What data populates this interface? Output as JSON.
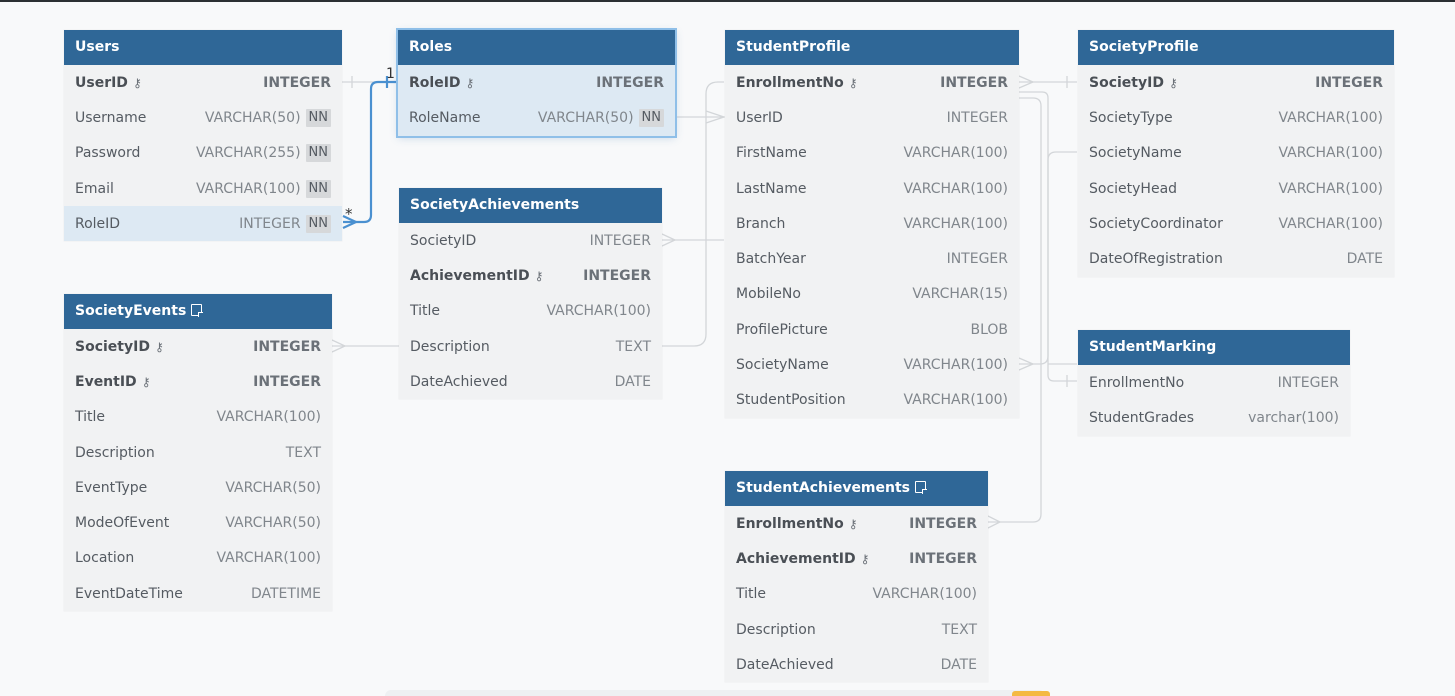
{
  "tables": {
    "users": {
      "name": "Users",
      "fields": [
        {
          "name": "UserID",
          "type": "INTEGER",
          "pk": true
        },
        {
          "name": "Username",
          "type": "VARCHAR(50)",
          "nn": "NN"
        },
        {
          "name": "Password",
          "type": "VARCHAR(255)",
          "nn": "NN"
        },
        {
          "name": "Email",
          "type": "VARCHAR(100)",
          "nn": "NN"
        },
        {
          "name": "RoleID",
          "type": "INTEGER",
          "nn": "NN"
        }
      ]
    },
    "roles": {
      "name": "Roles",
      "fields": [
        {
          "name": "RoleID",
          "type": "INTEGER",
          "pk": true
        },
        {
          "name": "RoleName",
          "type": "VARCHAR(50)",
          "nn": "NN"
        }
      ]
    },
    "society_achievements": {
      "name": "SocietyAchievements",
      "fields": [
        {
          "name": "SocietyID",
          "type": "INTEGER"
        },
        {
          "name": "AchievementID",
          "type": "INTEGER",
          "pk": true
        },
        {
          "name": "Title",
          "type": "VARCHAR(100)"
        },
        {
          "name": "Description",
          "type": "TEXT"
        },
        {
          "name": "DateAchieved",
          "type": "DATE"
        }
      ]
    },
    "society_events": {
      "name": "SocietyEvents",
      "fields": [
        {
          "name": "SocietyID",
          "type": "INTEGER",
          "pk": true
        },
        {
          "name": "EventID",
          "type": "INTEGER",
          "pk": true
        },
        {
          "name": "Title",
          "type": "VARCHAR(100)"
        },
        {
          "name": "Description",
          "type": "TEXT"
        },
        {
          "name": "EventType",
          "type": "VARCHAR(50)"
        },
        {
          "name": "ModeOfEvent",
          "type": "VARCHAR(50)"
        },
        {
          "name": "Location",
          "type": "VARCHAR(100)"
        },
        {
          "name": "EventDateTime",
          "type": "DATETIME"
        }
      ]
    },
    "student_profile": {
      "name": "StudentProfile",
      "fields": [
        {
          "name": "EnrollmentNo",
          "type": "INTEGER",
          "pk": true
        },
        {
          "name": "UserID",
          "type": "INTEGER"
        },
        {
          "name": "FirstName",
          "type": "VARCHAR(100)"
        },
        {
          "name": "LastName",
          "type": "VARCHAR(100)"
        },
        {
          "name": "Branch",
          "type": "VARCHAR(100)"
        },
        {
          "name": "BatchYear",
          "type": "INTEGER"
        },
        {
          "name": "MobileNo",
          "type": "VARCHAR(15)"
        },
        {
          "name": "ProfilePicture",
          "type": "BLOB"
        },
        {
          "name": "SocietyName",
          "type": "VARCHAR(100)"
        },
        {
          "name": "StudentPosition",
          "type": "VARCHAR(100)"
        }
      ]
    },
    "society_profile": {
      "name": "SocietyProfile",
      "fields": [
        {
          "name": "SocietyID",
          "type": "INTEGER",
          "pk": true
        },
        {
          "name": "SocietyType",
          "type": "VARCHAR(100)"
        },
        {
          "name": "SocietyName",
          "type": "VARCHAR(100)"
        },
        {
          "name": "SocietyHead",
          "type": "VARCHAR(100)"
        },
        {
          "name": "SocietyCoordinator",
          "type": "VARCHAR(100)"
        },
        {
          "name": "DateOfRegistration",
          "type": "DATE"
        }
      ]
    },
    "student_marking": {
      "name": "StudentMarking",
      "fields": [
        {
          "name": "EnrollmentNo",
          "type": "INTEGER"
        },
        {
          "name": "StudentGrades",
          "type": "varchar(100)"
        }
      ]
    },
    "student_achievements": {
      "name": "StudentAchievements",
      "fields": [
        {
          "name": "EnrollmentNo",
          "type": "INTEGER",
          "pk": true
        },
        {
          "name": "AchievementID",
          "type": "INTEGER",
          "pk": true
        },
        {
          "name": "Title",
          "type": "VARCHAR(100)"
        },
        {
          "name": "Description",
          "type": "TEXT"
        },
        {
          "name": "DateAchieved",
          "type": "DATE"
        }
      ]
    }
  },
  "relationship_labels": {
    "one": "1",
    "many": "*"
  },
  "colors": {
    "header": "#2f6797",
    "highlight": "#dde9f3",
    "selected_link": "#4a90d0",
    "link": "#cfd3d6"
  },
  "icons": {
    "primary_key": "key-icon",
    "table_note": "note-icon"
  }
}
